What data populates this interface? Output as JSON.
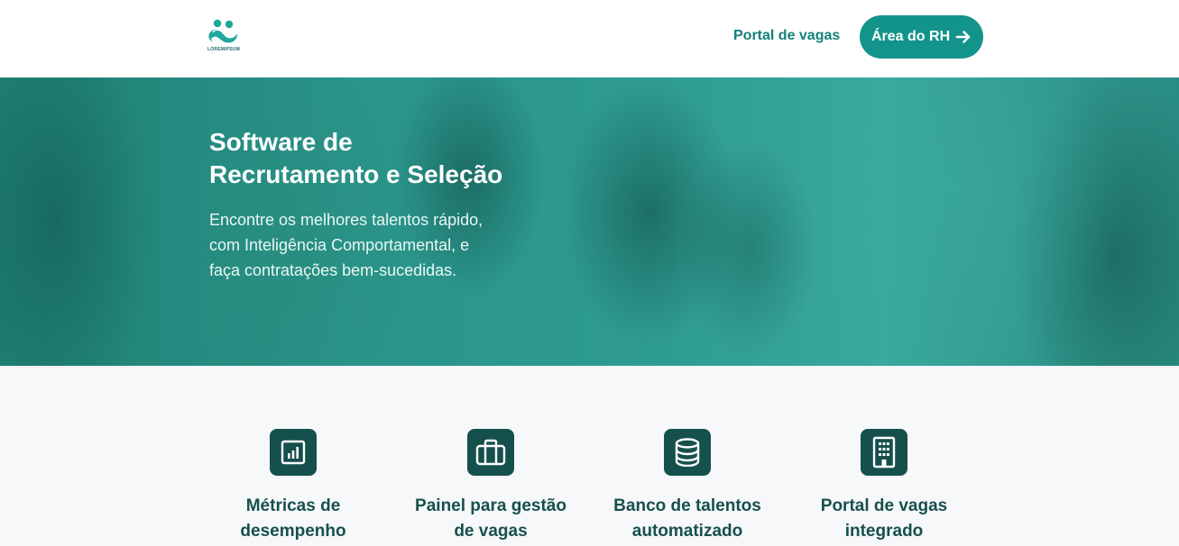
{
  "header": {
    "logo": {
      "name": "logo-icon",
      "text": "LOREMIPSUM"
    },
    "nav_link": "Portal de vagas",
    "rh_button": {
      "label": "Área do RH",
      "icon": "arrow-right-icon"
    }
  },
  "hero": {
    "title_line1": "Software de",
    "title_line2": "Recrutamento e Seleção",
    "subtitle_line1": "Encontre os melhores talentos rápido,",
    "subtitle_line2": "com Inteligência Comportamental, e",
    "subtitle_line3": "faça contratações bem-sucedidas."
  },
  "features": [
    {
      "icon": "bar-chart-icon",
      "line1": "Métricas de",
      "line2": "desempenho"
    },
    {
      "icon": "briefcase-icon",
      "line1": "Painel para gestão",
      "line2": "de vagas"
    },
    {
      "icon": "database-icon",
      "line1": "Banco de talentos",
      "line2": "automatizado"
    },
    {
      "icon": "building-icon",
      "line1": "Portal de vagas",
      "line2": "integrado"
    }
  ],
  "colors": {
    "brand": "#12948b",
    "dark": "#16504d",
    "hero_overlay": "#2a948a",
    "background": "#f6f8fa"
  }
}
